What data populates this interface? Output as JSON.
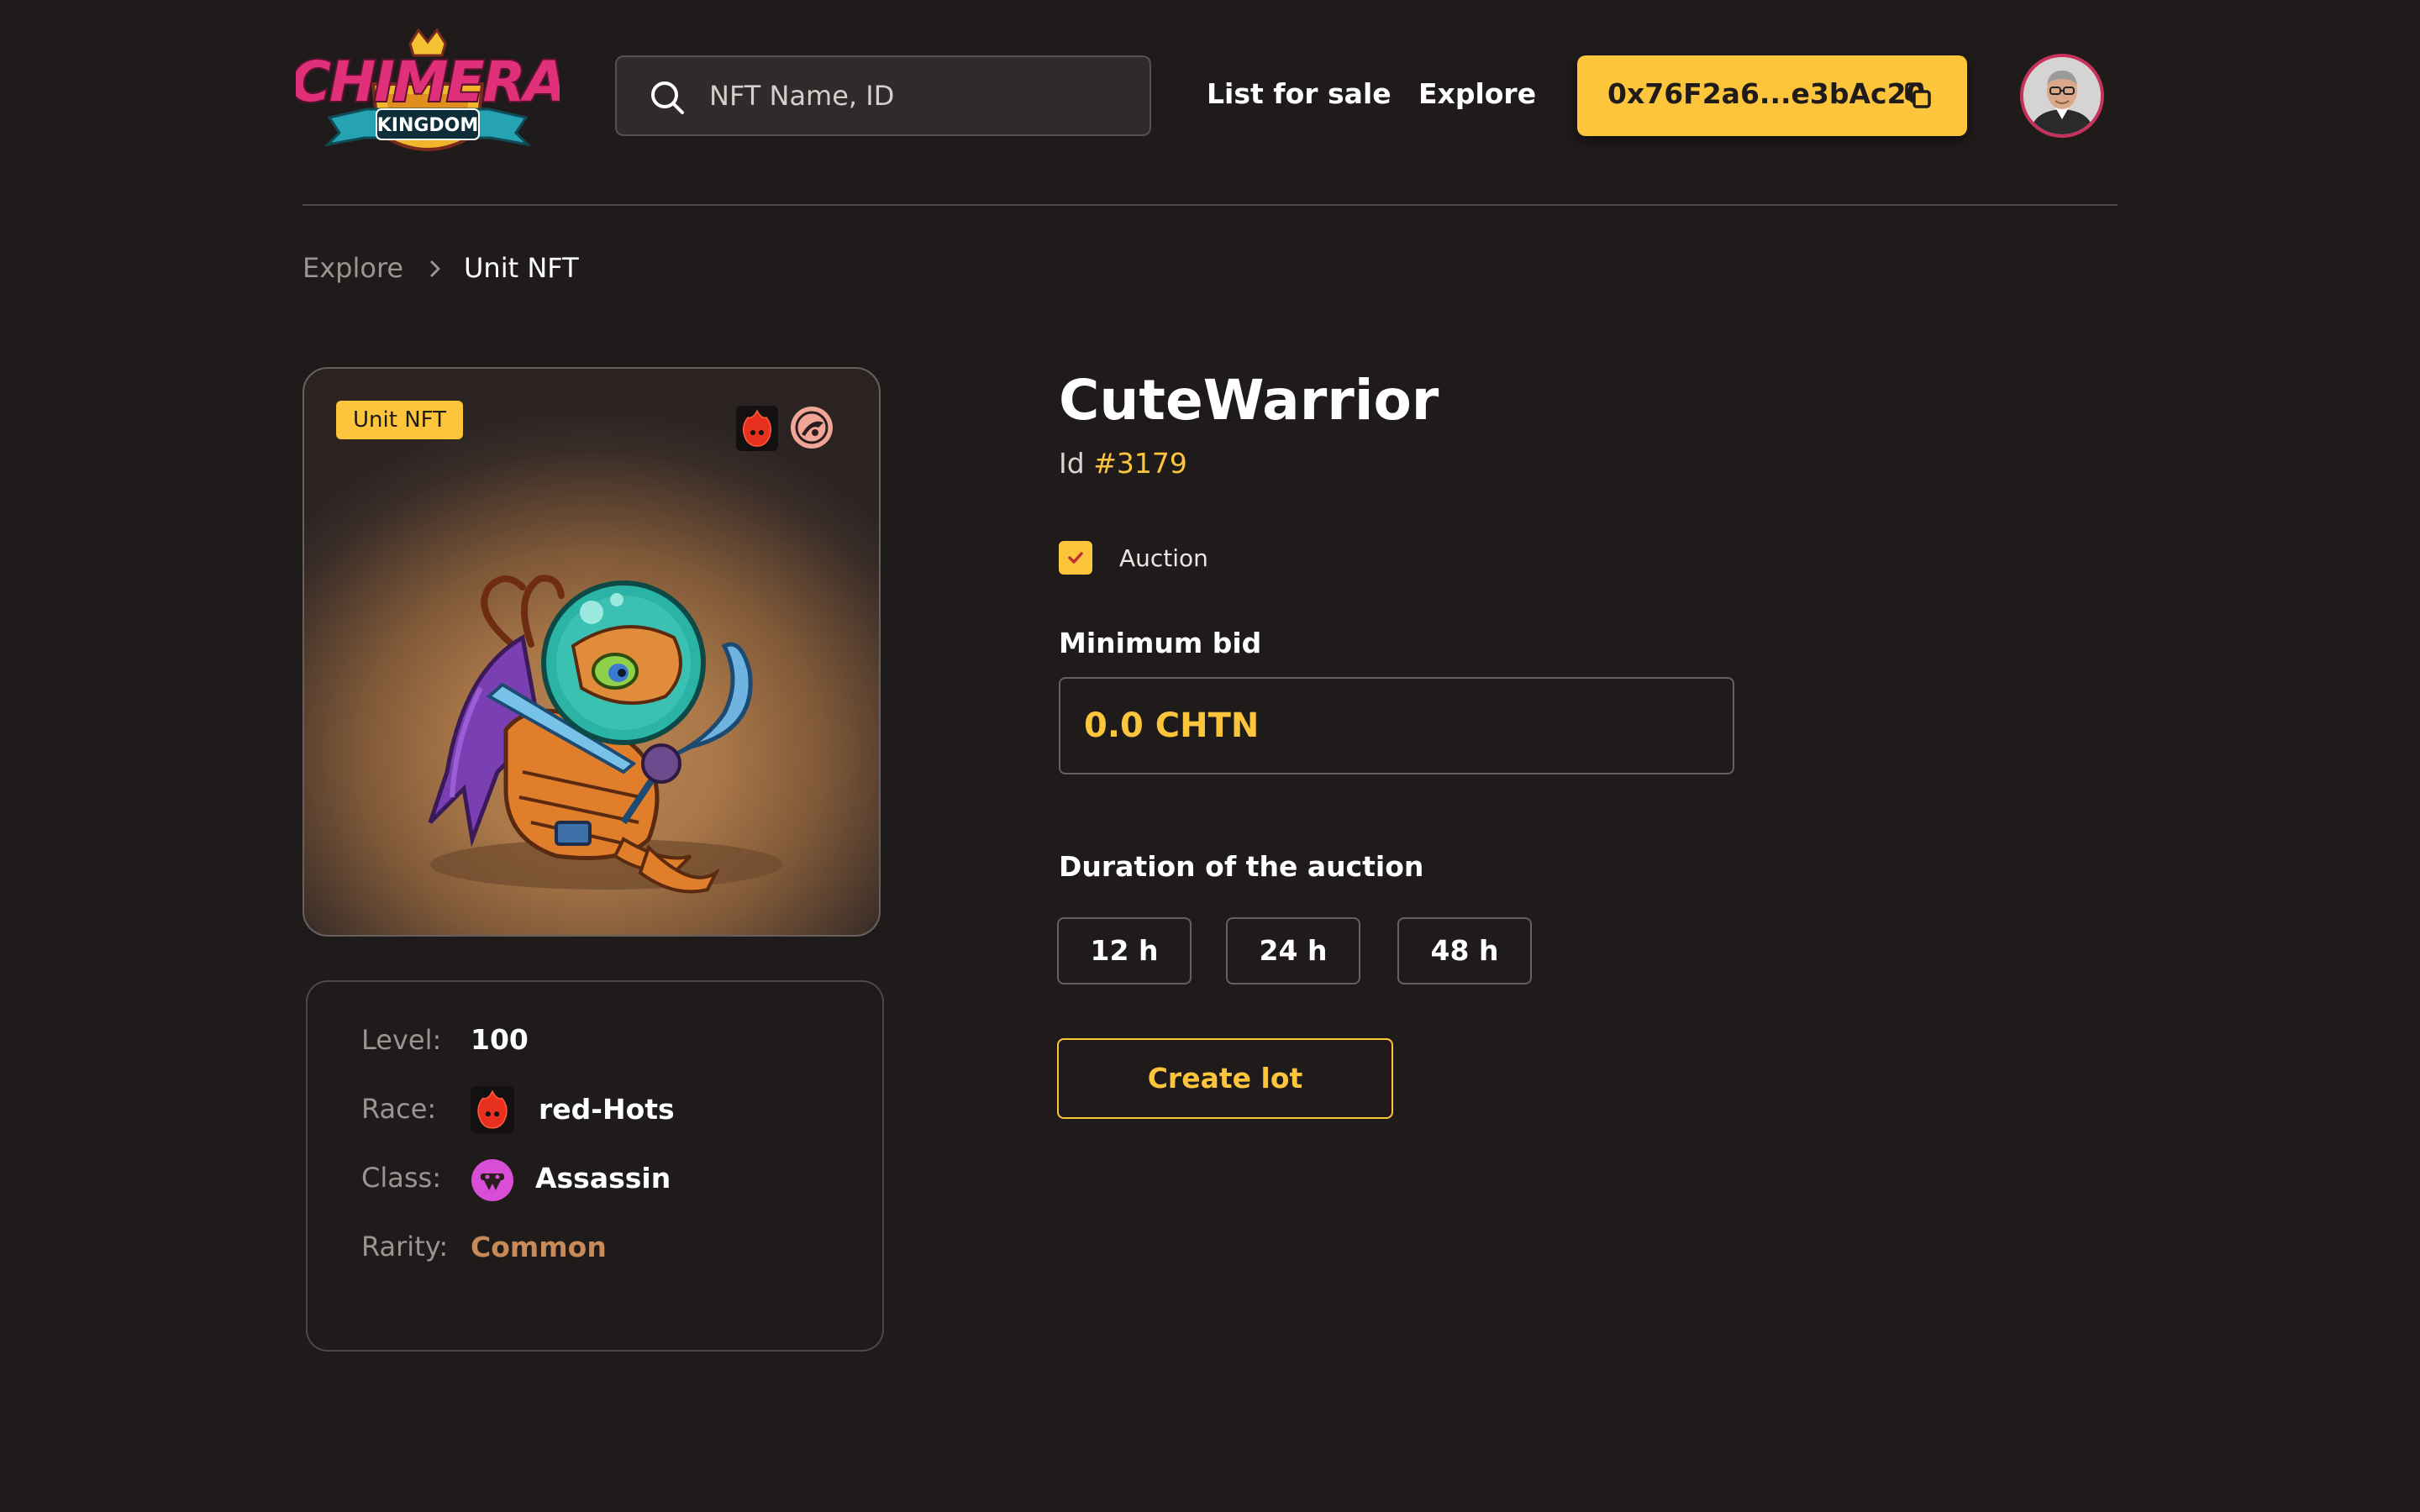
{
  "header": {
    "logo_text": "CHIMERA",
    "logo_subtext": "KINGDOM",
    "search_placeholder": "NFT Name, ID",
    "nav": {
      "list_for_sale": "List for sale",
      "explore": "Explore"
    },
    "wallet_address": "0x76F2a6...e3bAc20"
  },
  "breadcrumb": {
    "parent": "Explore",
    "current": "Unit NFT"
  },
  "nft": {
    "badge": "Unit NFT",
    "title": "CuteWarrior",
    "id_label": "Id",
    "id_value": "#3179"
  },
  "stats": {
    "level_label": "Level:",
    "level_value": "100",
    "race_label": "Race:",
    "race_value": "red-Hots",
    "class_label": "Class:",
    "class_value": "Assassin",
    "rarity_label": "Rarity:",
    "rarity_value": "Common"
  },
  "auction": {
    "checkbox_label": "Auction",
    "checked": true,
    "min_bid_label": "Minimum bid",
    "min_bid_value": "0.0 CHTN",
    "duration_label": "Duration of the auction",
    "durations": [
      "12 h",
      "24 h",
      "48 h"
    ],
    "create_button": "Create lot"
  },
  "colors": {
    "background": "#201b1b",
    "accent": "#fcc53c",
    "rarity_common": "#c88a58",
    "race_red": "#e8301e",
    "class_pink": "#d94ed6"
  },
  "icons": {
    "search": "search-icon",
    "copy": "copy-icon",
    "chevron": "chevron-right-icon",
    "race": "red-hots-flame-icon",
    "class": "assassin-icon",
    "check": "check-icon"
  }
}
